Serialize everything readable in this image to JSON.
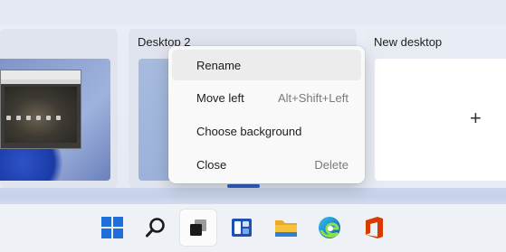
{
  "desktops": [
    {
      "label": ""
    },
    {
      "label": "Desktop 2"
    },
    {
      "label": "New desktop"
    }
  ],
  "context_menu": {
    "items": [
      {
        "label": "Rename",
        "shortcut": ""
      },
      {
        "label": "Move left",
        "shortcut": "Alt+Shift+Left"
      },
      {
        "label": "Choose background",
        "shortcut": ""
      },
      {
        "label": "Close",
        "shortcut": "Delete"
      }
    ]
  },
  "new_desktop_icon": "+",
  "taskbar": {
    "items": [
      {
        "name": "start",
        "icon": "windows-logo-icon"
      },
      {
        "name": "search",
        "icon": "search-icon"
      },
      {
        "name": "task-view",
        "icon": "task-view-icon"
      },
      {
        "name": "widgets",
        "icon": "widgets-icon"
      },
      {
        "name": "file-explorer",
        "icon": "folder-icon"
      },
      {
        "name": "edge",
        "icon": "edge-icon"
      },
      {
        "name": "office",
        "icon": "office-icon"
      }
    ]
  },
  "colors": {
    "accent": "#2f5ec2",
    "windows_blue": "#1e6fd9",
    "office_red": "#d83b01",
    "folder_yellow": "#f4c23c"
  }
}
